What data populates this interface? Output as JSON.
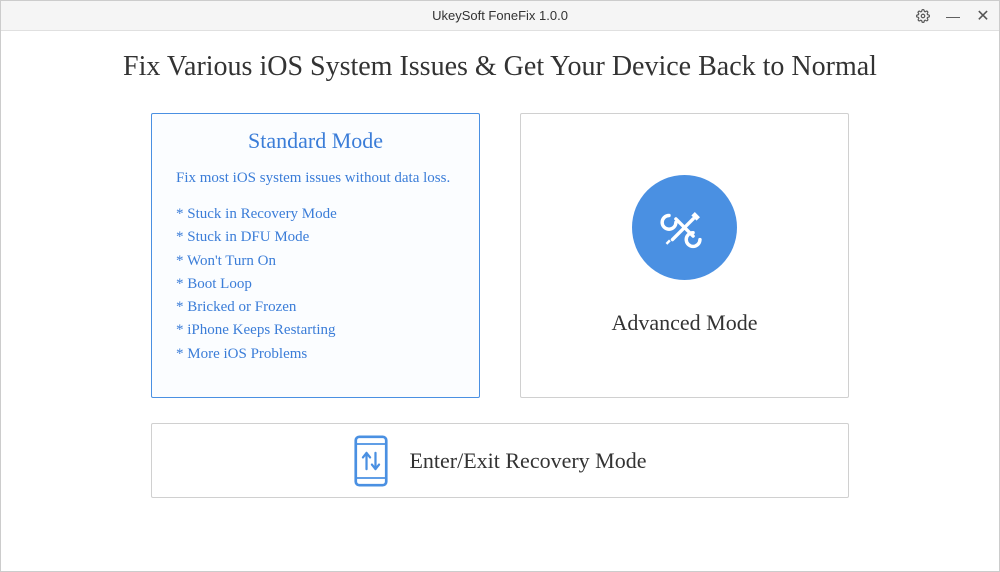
{
  "window": {
    "title": "UkeySoft FoneFix 1.0.0"
  },
  "page": {
    "heading": "Fix Various iOS System Issues & Get Your Device Back to Normal"
  },
  "standard": {
    "title": "Standard Mode",
    "description": "Fix most iOS system issues without data loss.",
    "issues": {
      "i0": "Stuck in Recovery Mode",
      "i1": "Stuck in DFU Mode",
      "i2": "Won't Turn On",
      "i3": "Boot Loop",
      "i4": "Bricked or Frozen",
      "i5": "iPhone Keeps Restarting",
      "i6": "More iOS Problems"
    }
  },
  "advanced": {
    "title": "Advanced Mode"
  },
  "recovery": {
    "label": "Enter/Exit Recovery Mode"
  },
  "colors": {
    "accent": "#4a90e2",
    "linkBlue": "#3b7dd8"
  }
}
